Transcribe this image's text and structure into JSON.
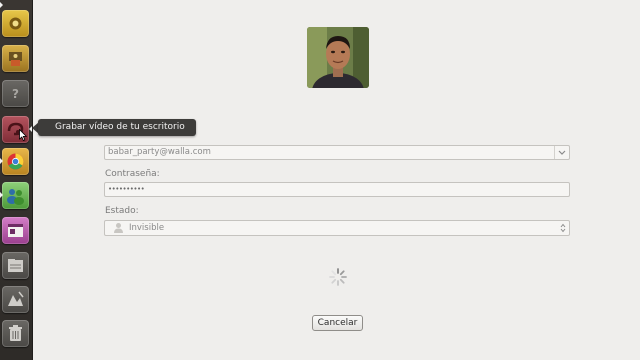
{
  "launcher": {
    "items": [
      {
        "name": "system-settings"
      },
      {
        "name": "app-two"
      },
      {
        "name": "help"
      },
      {
        "name": "screen-recorder"
      },
      {
        "name": "chromium"
      },
      {
        "name": "empathy"
      },
      {
        "name": "app-seven"
      },
      {
        "name": "files"
      },
      {
        "name": "app-nine"
      },
      {
        "name": "trash"
      }
    ]
  },
  "tooltip": {
    "text": "Grabar vídeo de tu escritorio"
  },
  "form": {
    "email_value": "babar_party@walla.com",
    "password_label": "Contraseña:",
    "password_value": "••••••••••",
    "state_label": "Estado:",
    "state_value": "Invisible"
  },
  "buttons": {
    "cancel_label": "Cancelar"
  },
  "colors": {
    "launcher_bg": "#2f2c29",
    "window_bg": "#efeeec",
    "tooltip_bg": "#3d3c3a"
  }
}
